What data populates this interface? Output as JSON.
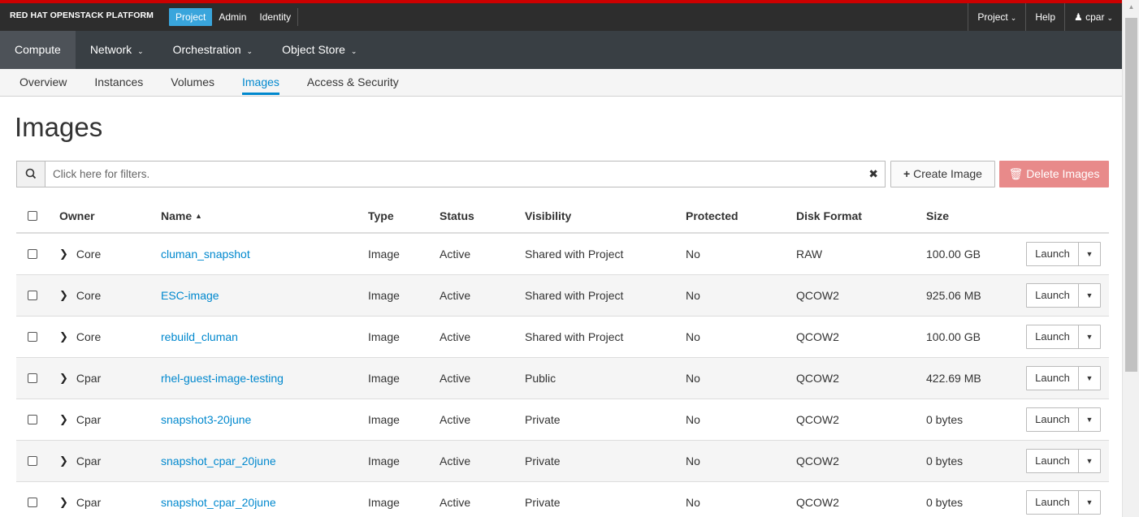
{
  "topbar": {
    "brand": "RED HAT OPENSTACK PLATFORM",
    "tabs": [
      {
        "label": "Project",
        "active": true
      },
      {
        "label": "Admin",
        "active": false
      },
      {
        "label": "Identity",
        "active": false
      }
    ],
    "project_menu": "Project",
    "help": "Help",
    "user": "cpar"
  },
  "nav_primary": [
    {
      "label": "Compute",
      "active": true
    },
    {
      "label": "Network",
      "has_dropdown": true
    },
    {
      "label": "Orchestration",
      "has_dropdown": true
    },
    {
      "label": "Object Store",
      "has_dropdown": true
    }
  ],
  "nav_secondary": [
    {
      "label": "Overview"
    },
    {
      "label": "Instances"
    },
    {
      "label": "Volumes"
    },
    {
      "label": "Images",
      "active": true
    },
    {
      "label": "Access & Security"
    }
  ],
  "page_title": "Images",
  "filter": {
    "placeholder": "Click here for filters.",
    "clear_icon": "times-icon",
    "search_icon": "search-icon"
  },
  "actions": {
    "create_label": "Create Image",
    "delete_label": "Delete Images",
    "delete_color": "#e88a8a"
  },
  "table": {
    "columns": [
      "Owner",
      "Name",
      "Type",
      "Status",
      "Visibility",
      "Protected",
      "Disk Format",
      "Size"
    ],
    "sort_indicator": "▲",
    "action_label": "Launch",
    "rows": [
      {
        "owner": "Core",
        "name": "cluman_snapshot",
        "type": "Image",
        "status": "Active",
        "visibility": "Shared with Project",
        "protected": "No",
        "disk_format": "RAW",
        "size": "100.00 GB"
      },
      {
        "owner": "Core",
        "name": "ESC-image",
        "type": "Image",
        "status": "Active",
        "visibility": "Shared with Project",
        "protected": "No",
        "disk_format": "QCOW2",
        "size": "925.06 MB"
      },
      {
        "owner": "Core",
        "name": "rebuild_cluman",
        "type": "Image",
        "status": "Active",
        "visibility": "Shared with Project",
        "protected": "No",
        "disk_format": "QCOW2",
        "size": "100.00 GB"
      },
      {
        "owner": "Cpar",
        "name": "rhel-guest-image-testing",
        "type": "Image",
        "status": "Active",
        "visibility": "Public",
        "protected": "No",
        "disk_format": "QCOW2",
        "size": "422.69 MB"
      },
      {
        "owner": "Cpar",
        "name": "snapshot3-20june",
        "type": "Image",
        "status": "Active",
        "visibility": "Private",
        "protected": "No",
        "disk_format": "QCOW2",
        "size": "0 bytes"
      },
      {
        "owner": "Cpar",
        "name": "snapshot_cpar_20june",
        "type": "Image",
        "status": "Active",
        "visibility": "Private",
        "protected": "No",
        "disk_format": "QCOW2",
        "size": "0 bytes"
      },
      {
        "owner": "Cpar",
        "name": "snapshot_cpar_20june",
        "type": "Image",
        "status": "Active",
        "visibility": "Private",
        "protected": "No",
        "disk_format": "QCOW2",
        "size": "0 bytes"
      }
    ]
  },
  "colors": {
    "accent": "#0088ce",
    "brand_red": "#cc0000",
    "active_tab": "#39a5dc"
  }
}
